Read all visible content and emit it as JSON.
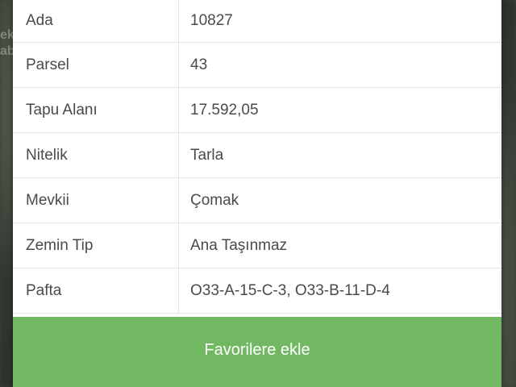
{
  "backdrop": {
    "partial_text": "ek\nab"
  },
  "parcel_info": {
    "rows": [
      {
        "label": "Ada",
        "value": "10827"
      },
      {
        "label": "Parsel",
        "value": "43"
      },
      {
        "label": "Tapu Alanı",
        "value": "17.592,05"
      },
      {
        "label": "Nitelik",
        "value": "Tarla"
      },
      {
        "label": "Mevkii",
        "value": "Çomak"
      },
      {
        "label": "Zemin Tip",
        "value": "Ana Taşınmaz"
      },
      {
        "label": "Pafta",
        "value": "O33-A-15-C-3, O33-B-11-D-4"
      }
    ]
  },
  "actions": {
    "favorite_label": "Favorilere ekle"
  },
  "colors": {
    "button_green": "#72b863",
    "text": "#4a4a4a",
    "divider": "#e4e4e4"
  }
}
